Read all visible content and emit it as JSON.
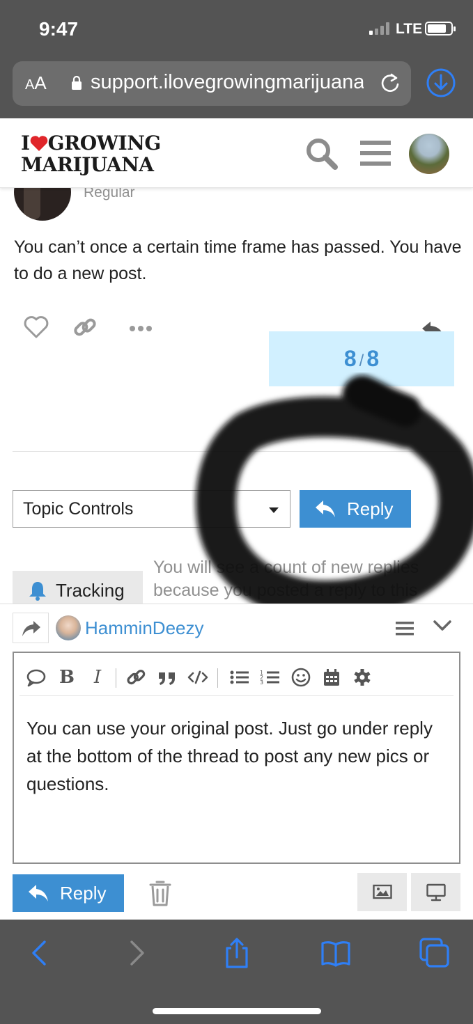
{
  "status_bar": {
    "time": "9:47",
    "network": "LTE"
  },
  "browser": {
    "text_size_label": "AA",
    "url": "support.ilovegrowingmarijuana.com"
  },
  "site_header": {
    "logo_line1_pre": "I",
    "logo_line1_post": "GROWING",
    "logo_line2": "MARIJUANA"
  },
  "post": {
    "author_role": "Regular",
    "body": "You can’t once a certain time frame has passed. You have to do a new post."
  },
  "progress": {
    "current": "8",
    "separator": "/",
    "total": "8"
  },
  "topic_footer": {
    "topic_controls_label": "Topic Controls",
    "reply_label": "Reply",
    "tracking_label": "Tracking",
    "tracking_desc_line1": "You will see a count of new replies",
    "tracking_desc_line2": "because you posted a reply to this"
  },
  "composer": {
    "username": "HamminDeezy",
    "draft_text": "You can use your original post. Just go under reply at the bottom of the thread to post any new pics or questions.",
    "reply_label": "Reply"
  },
  "colors": {
    "accent": "#3d8fd2",
    "progress_bg": "#d1f0ff",
    "heart": "#e0262b",
    "ios_bar": "#545454",
    "ios_blue": "#2f7ff6"
  }
}
